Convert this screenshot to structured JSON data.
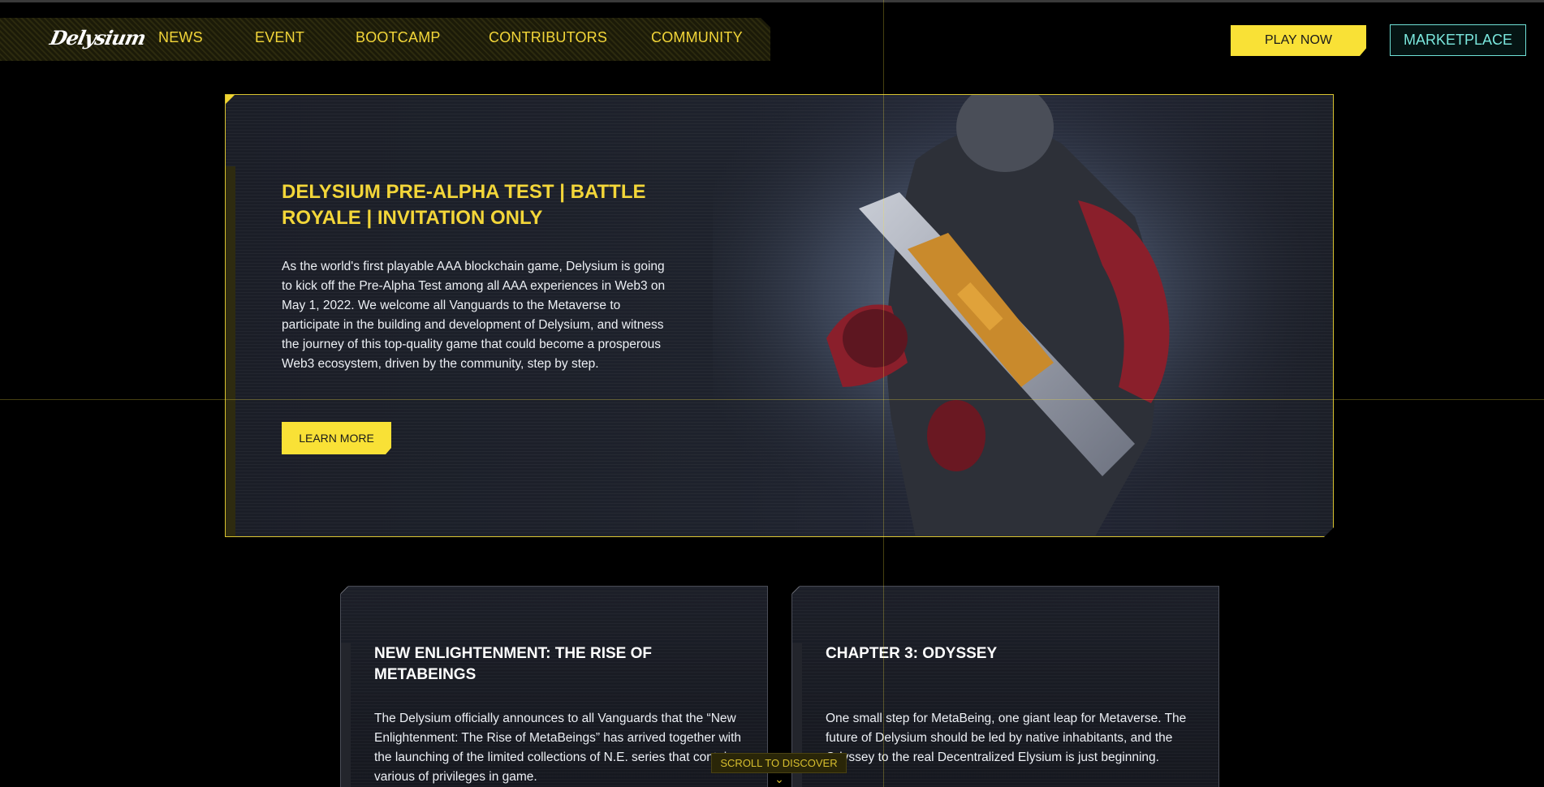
{
  "nav": {
    "logo_text": "Delysium",
    "items": [
      {
        "label": "NEWS"
      },
      {
        "label": "EVENT"
      },
      {
        "label": "BOOTCAMP"
      },
      {
        "label": "CONTRIBUTORS"
      },
      {
        "label": "COMMUNITY"
      }
    ],
    "play_label": "PLAY NOW",
    "market_label": "MARKETPLACE"
  },
  "hero": {
    "title": "DELYSIUM PRE-ALPHA TEST | BATTLE ROYALE | INVITATION ONLY",
    "body": "As the world's first playable AAA blockchain game, Delysium is going to kick off the Pre-Alpha Test among all AAA experiences in Web3 on May 1, 2022. We welcome all Vanguards to the Metaverse to participate in the building and development of Delysium, and witness the journey of this top-quality game that could become a prosperous Web3 ecosystem, driven by the community, step by step.",
    "button_label": "LEARN MORE"
  },
  "cards": [
    {
      "title": "NEW ENLIGHTENMENT: THE RISE OF METABEINGS",
      "body": "The Delysium officially announces to all Vanguards that the “New Enlightenment: The Rise of MetaBeings” has arrived together with the launching of the limited collections of N.E. series that contains various of privileges in game."
    },
    {
      "title": "CHAPTER 3: ODYSSEY",
      "body": "One small step for MetaBeing, one giant leap for Metaverse. The future of Delysium should be led by native inhabitants, and the Odyssey to the real Decentralized Elysium is just beginning."
    }
  ],
  "scroll": {
    "label": "SCROLL TO DISCOVER",
    "chevron": "⌄"
  },
  "colors": {
    "accent_yellow": "#f9e136",
    "accent_cyan": "#6fe0d6",
    "background": "#000000"
  }
}
